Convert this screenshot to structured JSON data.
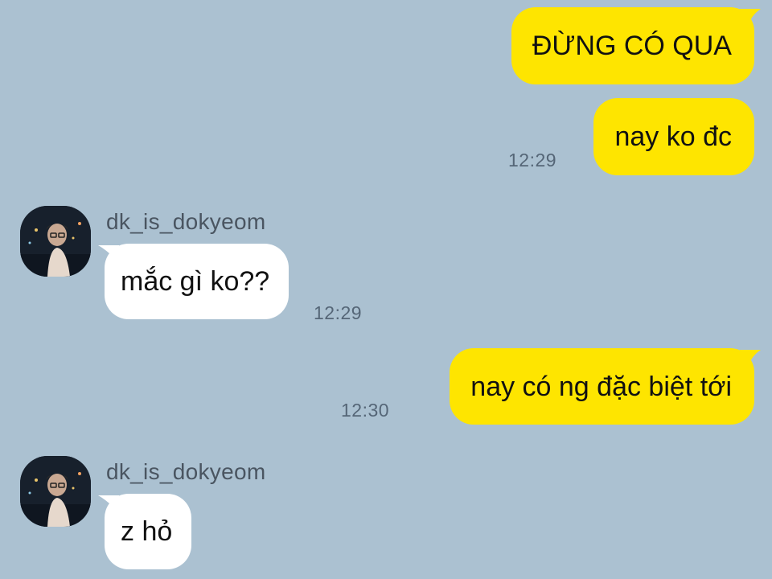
{
  "colors": {
    "background": "#abc1d1",
    "outgoing_bubble": "#fee500",
    "incoming_bubble": "#ffffff",
    "timestamp": "#556677"
  },
  "messages": [
    {
      "direction": "outgoing",
      "text": "ĐỪNG CÓ QUA"
    },
    {
      "direction": "outgoing",
      "text": "nay ko đc",
      "time": "12:29"
    },
    {
      "direction": "incoming",
      "sender": "dk_is_dokyeom",
      "avatar_icon": "profile-photo-avatar",
      "text": "mắc gì ko??",
      "time": "12:29"
    },
    {
      "direction": "outgoing",
      "text": "nay có ng đặc biệt tới",
      "time": "12:30"
    },
    {
      "direction": "incoming",
      "sender": "dk_is_dokyeom",
      "avatar_icon": "profile-photo-avatar",
      "text": "z hỏ"
    }
  ]
}
